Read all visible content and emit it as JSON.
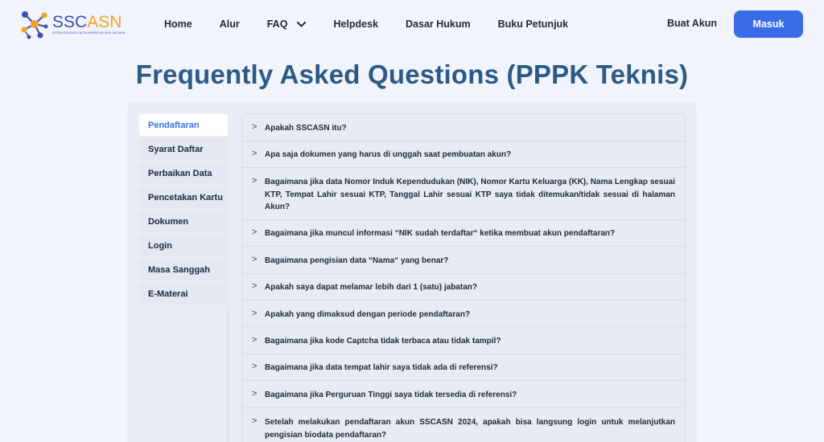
{
  "brand": {
    "name_part1": "SSC",
    "name_part2": "ASN",
    "tagline": "SISTEM SELEKSI CALON APARATUR SIPIL NEGARA",
    "colors": {
      "primary": "#3c4cb0",
      "accent": "#f2a32b"
    }
  },
  "nav": {
    "items": [
      {
        "label": "Home"
      },
      {
        "label": "Alur"
      },
      {
        "label": "FAQ",
        "icon": "chevron-down-icon"
      },
      {
        "label": "Helpdesk"
      },
      {
        "label": "Dasar Hukum"
      },
      {
        "label": "Buku Petunjuk"
      }
    ],
    "signup_label": "Buat Akun",
    "login_label": "Masuk",
    "login_color": "#3b6ce7"
  },
  "page": {
    "title": "Frequently Asked Questions (PPPK Teknis)",
    "title_color": "#2c5a86"
  },
  "sidebar": {
    "active_index": 0,
    "items": [
      {
        "label": "Pendaftaran"
      },
      {
        "label": "Syarat Daftar"
      },
      {
        "label": "Perbaikan Data"
      },
      {
        "label": "Pencetakan Kartu"
      },
      {
        "label": "Dokumen"
      },
      {
        "label": "Login"
      },
      {
        "label": "Masa Sanggah"
      },
      {
        "label": "E-Materai"
      }
    ]
  },
  "faq": {
    "items": [
      {
        "question": "Apakah SSCASN itu?"
      },
      {
        "question": "Apa saja dokumen yang harus di unggah saat pembuatan akun?"
      },
      {
        "question": "Bagaimana jika data Nomor Induk Kependudukan (NIK), Nomor Kartu Keluarga (KK), Nama Lengkap sesuai KTP, Tempat Lahir sesuai KTP, Tanggal Lahir sesuai KTP saya tidak ditemukan/tidak sesuai di halaman Akun?"
      },
      {
        "question": "Bagaimana jika muncul informasi “NIK sudah terdaftar“ ketika membuat akun pendaftaran?"
      },
      {
        "question": "Bagaimana pengisian data “Nama“ yang benar?"
      },
      {
        "question": "Apakah saya dapat melamar lebih dari 1 (satu) jabatan?"
      },
      {
        "question": "Apakah yang dimaksud dengan periode pendaftaran?"
      },
      {
        "question": "Bagaimana jika kode Captcha tidak terbaca atau tidak tampil?"
      },
      {
        "question": "Bagaimana jika data tempat lahir saya tidak ada di referensi?"
      },
      {
        "question": "Bagaimana jika Perguruan Tinggi saya tidak tersedia di referensi?"
      },
      {
        "question": "Setelah melakukan pendaftaran akun SSCASN 2024, apakah bisa langsung login untuk melanjutkan pengisian biodata pendaftaran?"
      }
    ]
  }
}
